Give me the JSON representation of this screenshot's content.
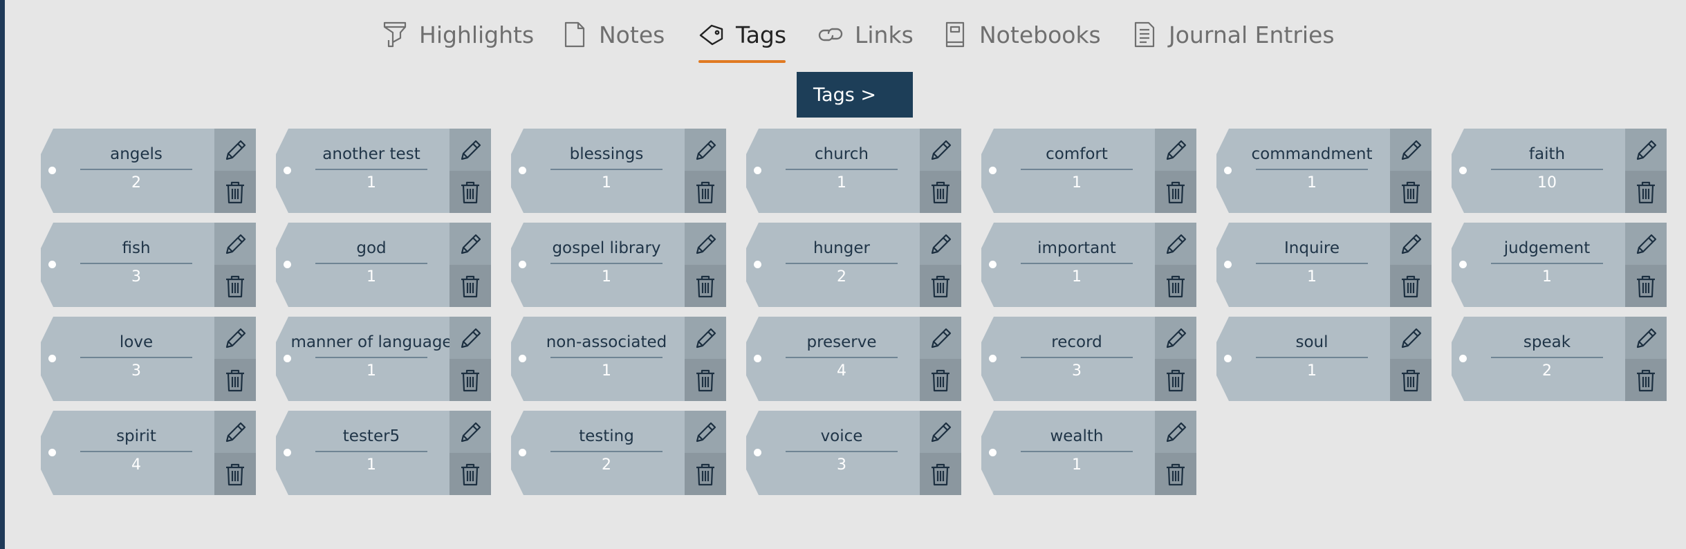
{
  "nav": {
    "tabs": [
      {
        "label": "Highlights",
        "icon": "highlighter-icon"
      },
      {
        "label": "Notes",
        "icon": "note-icon"
      },
      {
        "label": "Tags",
        "icon": "tag-icon",
        "active": true
      },
      {
        "label": "Links",
        "icon": "link-icon"
      },
      {
        "label": "Notebooks",
        "icon": "notebook-icon"
      },
      {
        "label": "Journal Entries",
        "icon": "journal-icon"
      }
    ],
    "accent_color": "#e07a22"
  },
  "breadcrumb": {
    "label": "Tags >"
  },
  "tags": [
    {
      "name": "angels",
      "count": "2"
    },
    {
      "name": "another test",
      "count": "1"
    },
    {
      "name": "blessings",
      "count": "1"
    },
    {
      "name": "church",
      "count": "1"
    },
    {
      "name": "comfort",
      "count": "1"
    },
    {
      "name": "commandment",
      "count": "1"
    },
    {
      "name": "faith",
      "count": "10"
    },
    {
      "name": "fish",
      "count": "3"
    },
    {
      "name": "god",
      "count": "1"
    },
    {
      "name": "gospel library",
      "count": "1"
    },
    {
      "name": "hunger",
      "count": "2"
    },
    {
      "name": "important",
      "count": "1"
    },
    {
      "name": "Inquire",
      "count": "1"
    },
    {
      "name": "judgement",
      "count": "1"
    },
    {
      "name": "love",
      "count": "3"
    },
    {
      "name": "manner of language",
      "count": "1"
    },
    {
      "name": "non-associated",
      "count": "1"
    },
    {
      "name": "preserve",
      "count": "4"
    },
    {
      "name": "record",
      "count": "3"
    },
    {
      "name": "soul",
      "count": "1"
    },
    {
      "name": "speak",
      "count": "2"
    },
    {
      "name": "spirit",
      "count": "4"
    },
    {
      "name": "tester5",
      "count": "1"
    },
    {
      "name": "testing",
      "count": "2"
    },
    {
      "name": "voice",
      "count": "3"
    },
    {
      "name": "wealth",
      "count": "1"
    }
  ],
  "colors": {
    "tag_body": "#b1bdc5",
    "edit_bg": "#98a5ad",
    "delete_bg": "#8b979f",
    "breadcrumb_bg": "#1d3e58"
  }
}
